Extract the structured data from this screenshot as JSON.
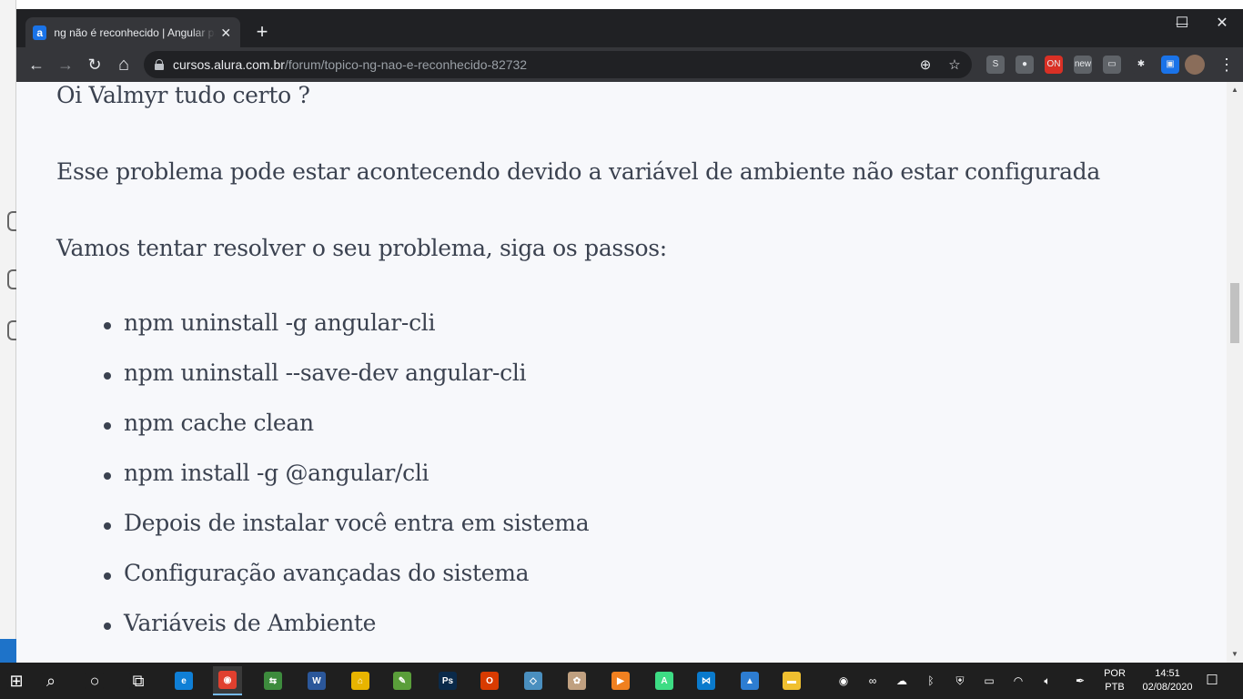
{
  "browser": {
    "tab": {
      "favicon": "a",
      "title": "ng não é reconhecido | Angular para iniciantes",
      "close": "✕"
    },
    "new_tab": "+",
    "window_controls": {
      "minimize": "—",
      "maximize": "☐",
      "close": "✕"
    },
    "nav": {
      "back": "←",
      "forward": "→",
      "reload": "↻",
      "home": "⌂"
    },
    "address": {
      "host": "cursos.alura.com.br",
      "path": "/forum/topico-ng-nao-e-reconhecido-82732"
    },
    "omnibox_icons": {
      "zoom": "zoom-icon",
      "bookmark": "star-icon"
    },
    "extensions": [
      {
        "name": "skype-extension",
        "glyph": "S",
        "color": "#5f6368"
      },
      {
        "name": "record-extension",
        "glyph": "●",
        "color": "#5f6368"
      },
      {
        "name": "on-air-extension",
        "glyph": "ON",
        "color": "#d93025"
      },
      {
        "name": "news-extension",
        "glyph": "new",
        "color": "#5f6368"
      },
      {
        "name": "screen-extension",
        "glyph": "▭",
        "color": "#5f6368"
      },
      {
        "name": "extensions-puzzle",
        "glyph": "✱",
        "color": "#35363a"
      },
      {
        "name": "cast-extension",
        "glyph": "▣",
        "color": "#1a73e8"
      }
    ],
    "menu": "⋮"
  },
  "post": {
    "greeting": "Oi Valmyr tudo certo ?",
    "explanation": "Esse problema pode estar acontecendo devido a variável de ambiente não estar configurada",
    "intro_steps": "Vamos tentar resolver o seu problema, siga os passos:",
    "steps": [
      "npm uninstall -g angular-cli",
      "npm uninstall --save-dev angular-cli",
      "npm cache clean",
      "npm install -g @angular/cli",
      "Depois de instalar você entra em sistema",
      "Configuração avançadas do sistema",
      "Variáveis de Ambiente"
    ]
  },
  "taskbar": {
    "apps": [
      {
        "name": "start-button",
        "glyph": "⊞",
        "color": "#1f1f1f"
      },
      {
        "name": "search-button",
        "glyph": "⌕",
        "color": "#1f1f1f"
      },
      {
        "name": "cortana-button",
        "glyph": "○",
        "color": "#1f1f1f"
      },
      {
        "name": "task-view-button",
        "glyph": "⧉",
        "color": "#1f1f1f"
      },
      {
        "name": "edge-app",
        "glyph": "e",
        "color": "#0f7fd6"
      },
      {
        "name": "chrome-app",
        "glyph": "◉",
        "color": "#e0402f"
      },
      {
        "name": "network-app",
        "glyph": "⇆",
        "color": "#3d8b3d"
      },
      {
        "name": "word-app",
        "glyph": "W",
        "color": "#2b579a"
      },
      {
        "name": "remote-app",
        "glyph": "⌂",
        "color": "#e8b400"
      },
      {
        "name": "notepad-app",
        "glyph": "✎",
        "color": "#5a9e3a"
      },
      {
        "name": "photoshop-app",
        "glyph": "Ps",
        "color": "#0a2a4a"
      },
      {
        "name": "office-app",
        "glyph": "O",
        "color": "#d83b01"
      },
      {
        "name": "sketch-app",
        "glyph": "◇",
        "color": "#4a8fbf"
      },
      {
        "name": "paint-app",
        "glyph": "✿",
        "color": "#c0a080"
      },
      {
        "name": "media-app",
        "glyph": "▶",
        "color": "#f08020"
      },
      {
        "name": "android-studio-app",
        "glyph": "A",
        "color": "#3ddc84"
      },
      {
        "name": "vscode-app",
        "glyph": "⋈",
        "color": "#0a7acc"
      },
      {
        "name": "photos-app",
        "glyph": "▲",
        "color": "#2d7dd2"
      },
      {
        "name": "explorer-app",
        "glyph": "▬",
        "color": "#f0c030"
      }
    ],
    "tray": [
      {
        "name": "chrome-tray",
        "glyph": "◉"
      },
      {
        "name": "link-tray",
        "glyph": "∞"
      },
      {
        "name": "onedrive-tray",
        "glyph": "☁"
      },
      {
        "name": "bluetooth-tray",
        "glyph": "ᛒ"
      },
      {
        "name": "defender-tray",
        "glyph": "⛨"
      },
      {
        "name": "battery-tray",
        "glyph": "▭"
      },
      {
        "name": "wifi-tray",
        "glyph": "◠"
      },
      {
        "name": "volume-tray",
        "glyph": "🔈︎"
      },
      {
        "name": "pen-tray",
        "glyph": "✒"
      }
    ],
    "language": {
      "line1": "POR",
      "line2": "PTB"
    },
    "clock": {
      "time": "14:51",
      "date": "02/08/2020"
    },
    "notifications": "☐"
  }
}
